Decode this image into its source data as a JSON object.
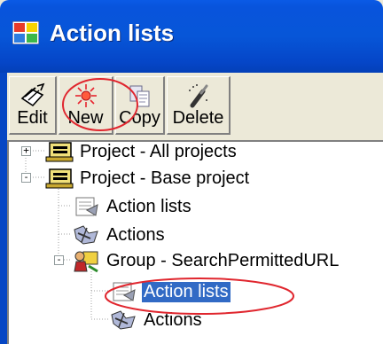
{
  "window": {
    "title": "Action lists"
  },
  "toolbar": {
    "buttons": [
      {
        "label": "Edit",
        "icon": "edit-icon"
      },
      {
        "label": "New",
        "icon": "new-icon"
      },
      {
        "label": "Copy",
        "icon": "copy-icon"
      },
      {
        "label": "Delete",
        "icon": "delete-icon"
      }
    ]
  },
  "tree": {
    "nodes": [
      {
        "label": "Project - All projects",
        "icon": "project-icon",
        "expander": "+"
      },
      {
        "label": "Project - Base project",
        "icon": "project-icon",
        "expander": "-"
      },
      {
        "label": "Action lists",
        "icon": "action-list-icon"
      },
      {
        "label": "Actions",
        "icon": "actions-icon"
      },
      {
        "label": "Group - SearchPermittedURL",
        "icon": "group-icon",
        "expander": "-"
      },
      {
        "label": "Action lists",
        "icon": "action-list-icon",
        "selected": true
      },
      {
        "label": "Actions",
        "icon": "actions-icon"
      }
    ]
  },
  "colors": {
    "title_bar": "#0756d8",
    "selection": "#316ac5",
    "highlight_oval": "#e0262e"
  }
}
